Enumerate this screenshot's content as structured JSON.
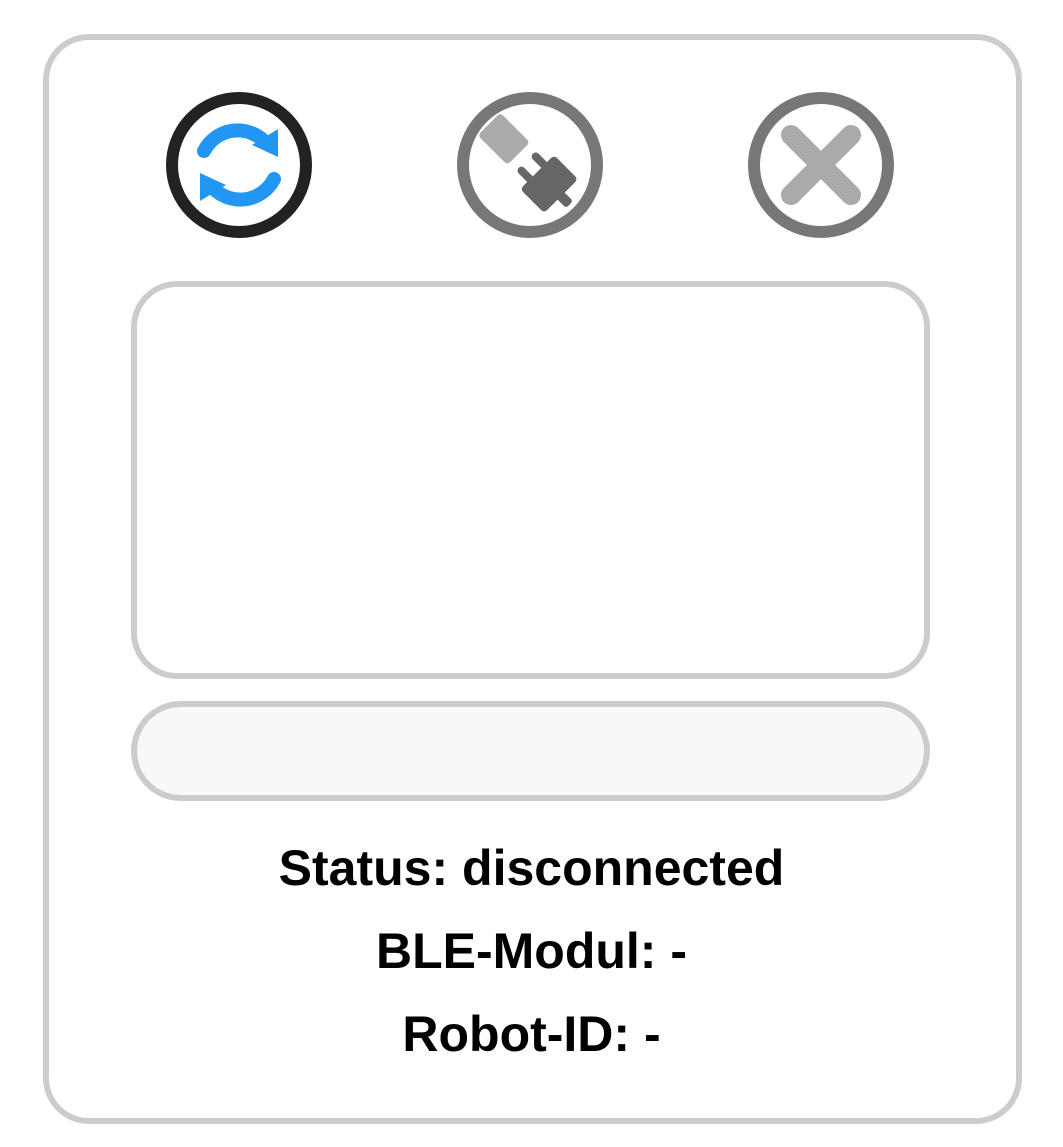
{
  "toolbar": {
    "refresh_icon": "refresh-icon",
    "connect_icon": "plug-icon",
    "close_icon": "close-icon"
  },
  "device_list": {
    "items": []
  },
  "input": {
    "value": "",
    "placeholder": ""
  },
  "info": {
    "status": "Status: disconnected",
    "ble_module": "BLE-Modul: -",
    "robot_id": "Robot-ID: -"
  },
  "colors": {
    "accent_blue": "#2196f3",
    "active_ring": "#222222",
    "disabled_ring": "#777777",
    "disabled_fill": "#aaaaaa",
    "border": "#cccccc"
  }
}
